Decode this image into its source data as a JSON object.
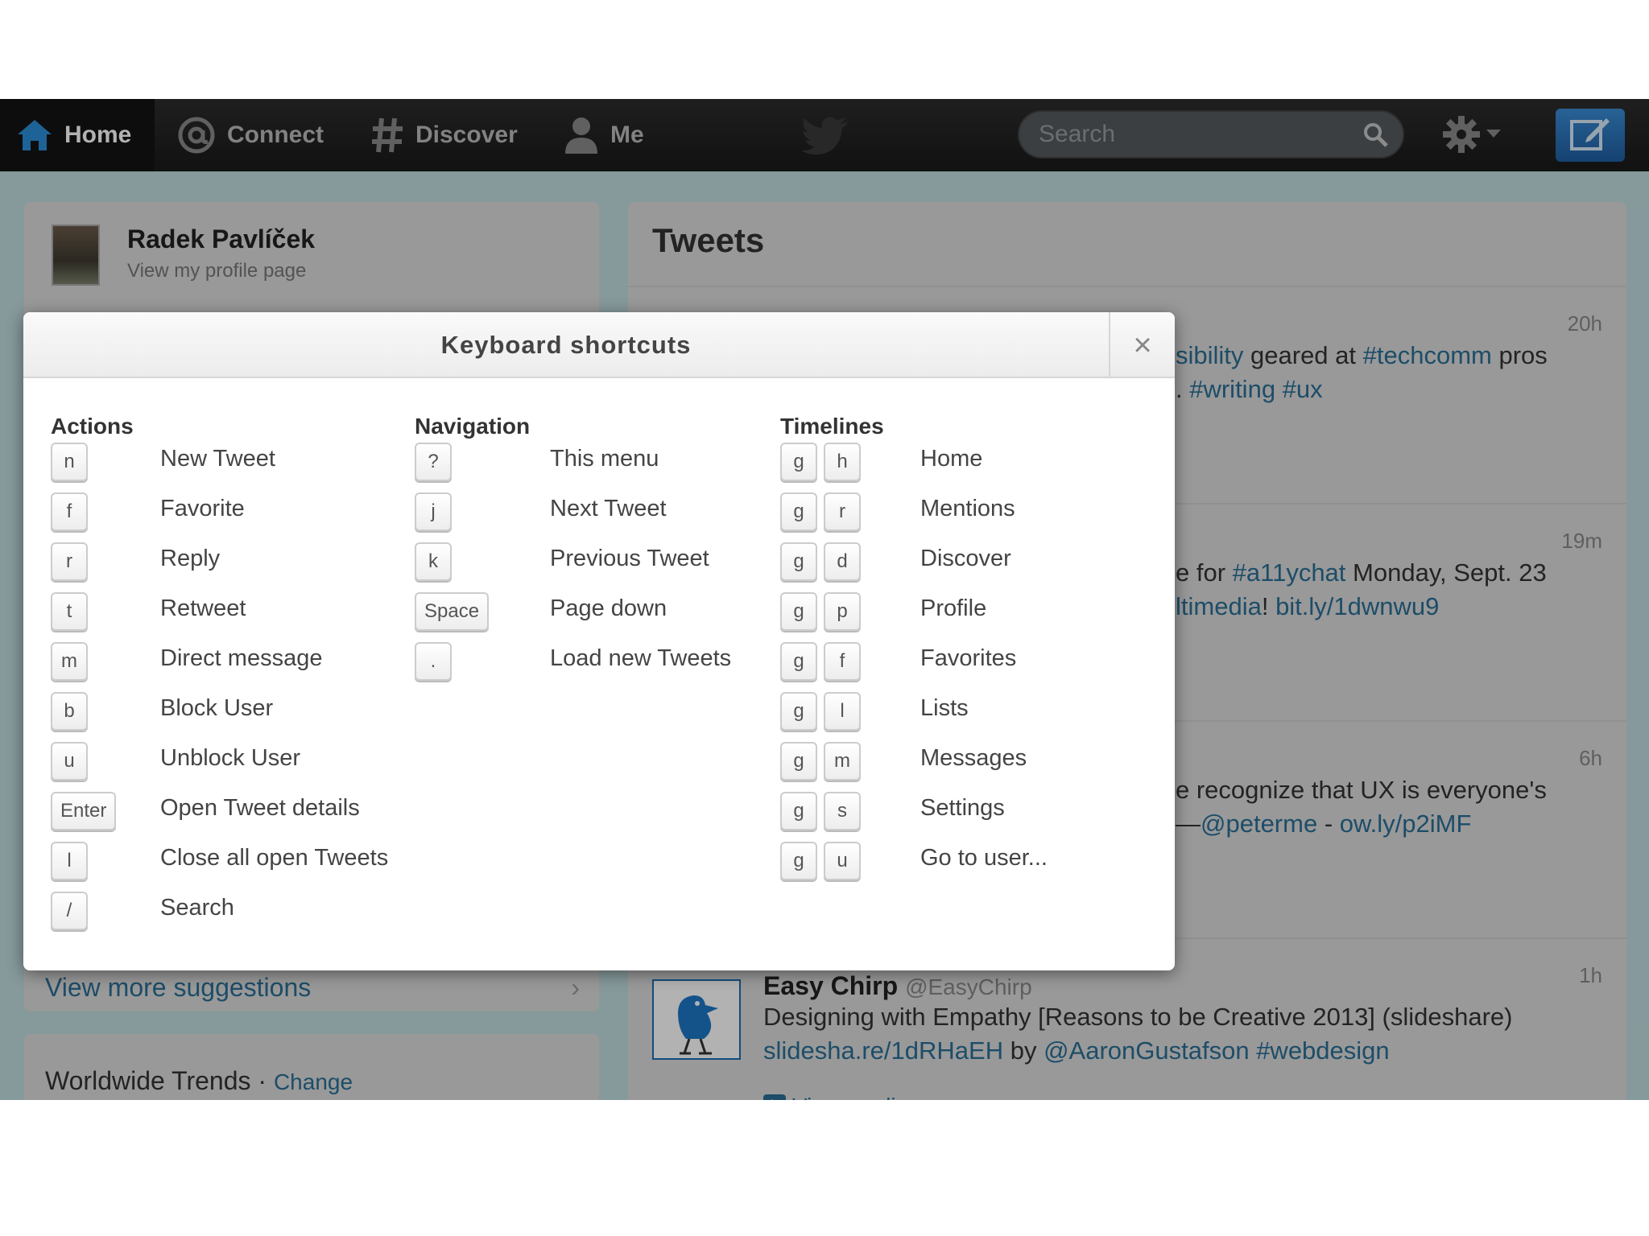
{
  "topbar": {
    "nav": [
      {
        "label": "Home",
        "icon": "home-icon",
        "active": true
      },
      {
        "label": "Connect",
        "icon": "at-icon",
        "active": false
      },
      {
        "label": "Discover",
        "icon": "hash-icon",
        "active": false
      },
      {
        "label": "Me",
        "icon": "user-icon",
        "active": false
      }
    ],
    "search_placeholder": "Search"
  },
  "profile": {
    "name": "Radek Pavlíček",
    "link": "View my profile page"
  },
  "suggestions": {
    "view_more": "View more suggestions"
  },
  "trends": {
    "title": "Worldwide Trends",
    "separator": "·",
    "change": "Change"
  },
  "tweets": {
    "title": "Tweets",
    "items": [
      {
        "time": "20h",
        "line1": [
          "sibility",
          " geared at ",
          "#techcomm",
          " pros"
        ],
        "line2": [
          ". ",
          "#writing",
          " ",
          "#ux"
        ]
      },
      {
        "time": "19m",
        "line1": [
          "e for ",
          "#a11ychat",
          " Monday, Sept. 23"
        ],
        "line2": [
          "ltimedia",
          "! ",
          "bit.ly/1dwnwu9"
        ]
      },
      {
        "time": "6h",
        "line1": [
          "e recognize that UX is everyone's"
        ],
        "line2": [
          "—",
          "@peterme",
          " - ",
          "ow.ly/p2iMF"
        ]
      },
      {
        "time": "1h",
        "name": "Easy Chirp",
        "handle": "@EasyChirp",
        "line1": [
          "Designing with Empathy [Reasons to be Creative 2013] (slideshare)"
        ],
        "line2": [
          "slidesha.re/1dRHaEH",
          " by ",
          "@AaronGustafson",
          " ",
          "#webdesign"
        ],
        "media": "View media"
      }
    ]
  },
  "modal": {
    "title": "Keyboard shortcuts",
    "close": "×",
    "columns": [
      {
        "heading": "Actions",
        "rows": [
          {
            "keys": [
              "n"
            ],
            "desc": "New Tweet"
          },
          {
            "keys": [
              "f"
            ],
            "desc": "Favorite"
          },
          {
            "keys": [
              "r"
            ],
            "desc": "Reply"
          },
          {
            "keys": [
              "t"
            ],
            "desc": "Retweet"
          },
          {
            "keys": [
              "m"
            ],
            "desc": "Direct message"
          },
          {
            "keys": [
              "b"
            ],
            "desc": "Block User"
          },
          {
            "keys": [
              "u"
            ],
            "desc": "Unblock User"
          },
          {
            "keys": [
              "Enter"
            ],
            "desc": "Open Tweet details"
          },
          {
            "keys": [
              "l"
            ],
            "desc": "Close all open Tweets"
          },
          {
            "keys": [
              "/"
            ],
            "desc": "Search"
          }
        ]
      },
      {
        "heading": "Navigation",
        "rows": [
          {
            "keys": [
              "?"
            ],
            "desc": "This menu"
          },
          {
            "keys": [
              "j"
            ],
            "desc": "Next Tweet"
          },
          {
            "keys": [
              "k"
            ],
            "desc": "Previous Tweet"
          },
          {
            "keys": [
              "Space"
            ],
            "desc": "Page down"
          },
          {
            "keys": [
              "."
            ],
            "desc": "Load new Tweets"
          }
        ]
      },
      {
        "heading": "Timelines",
        "rows": [
          {
            "keys": [
              "g",
              "h"
            ],
            "desc": "Home"
          },
          {
            "keys": [
              "g",
              "r"
            ],
            "desc": "Mentions"
          },
          {
            "keys": [
              "g",
              "d"
            ],
            "desc": "Discover"
          },
          {
            "keys": [
              "g",
              "p"
            ],
            "desc": "Profile"
          },
          {
            "keys": [
              "g",
              "f"
            ],
            "desc": "Favorites"
          },
          {
            "keys": [
              "g",
              "l"
            ],
            "desc": "Lists"
          },
          {
            "keys": [
              "g",
              "m"
            ],
            "desc": "Messages"
          },
          {
            "keys": [
              "g",
              "s"
            ],
            "desc": "Settings"
          },
          {
            "keys": [
              "g",
              "u"
            ],
            "desc": "Go to user..."
          }
        ]
      }
    ]
  },
  "colors": {
    "link": "#2a6f96",
    "topbar": "#1f1f1f",
    "compose": "#2f7cc4"
  }
}
